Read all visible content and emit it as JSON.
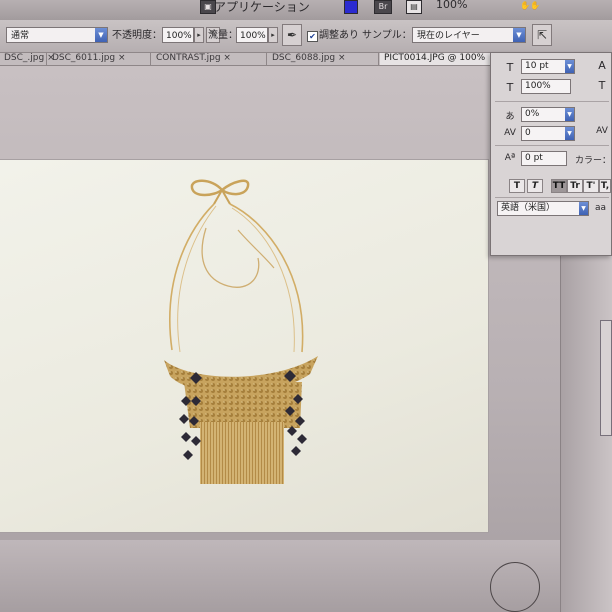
{
  "appbar": {
    "app_menu_label": "アプリケーション",
    "icon_br": "Br",
    "zoom": "100%"
  },
  "options": {
    "blend_mode": "通常",
    "opacity_label": "不透明度：",
    "opacity_value": "100%",
    "flow_label": "流量：",
    "flow_value": "100%",
    "aligned_label": "調整あり",
    "sample_label": "サンプル：",
    "sample_value": "現在のレイヤー"
  },
  "tabs": [
    {
      "label": "DSC_.jpg ×"
    },
    {
      "label": "DSC_6011.jpg ×"
    },
    {
      "label": "CONTRAST.jpg ×"
    },
    {
      "label": "DSC_6088.jpg ×"
    },
    {
      "label": "PICT0014.JPG @ 100%"
    }
  ],
  "character_panel": {
    "font_size": "10 pt",
    "leading": "100%",
    "tracking": "0%",
    "kerning": "0",
    "baseline_shift": "0 pt",
    "color_label": "カラー：",
    "language": "英語（米国）",
    "aa_label": "aa",
    "style_buttons": [
      "T",
      "T",
      "TT",
      "Tr",
      "T'",
      "T,"
    ]
  },
  "colors": {
    "accent_blue": "#3f62b4",
    "canvas": "#eeede4",
    "necklace_gold": "#c9a35a",
    "necklace_dark": "#2d2a36"
  }
}
